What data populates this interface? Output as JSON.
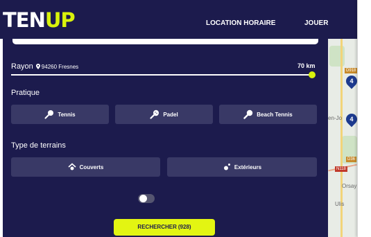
{
  "header": {
    "logo_part1": "TEN",
    "logo_part2": "UP",
    "nav": [
      "LOCATION HORAIRE",
      "JOUER"
    ]
  },
  "search": {
    "rayon_label": "Rayon",
    "location": "94260 Fresnes",
    "distance": "70 km",
    "distance_fraction": 1.0
  },
  "pratique": {
    "title": "Pratique",
    "options": [
      "Tennis",
      "Padel",
      "Beach Tennis"
    ]
  },
  "terrain": {
    "title": "Type de terrains",
    "options": [
      "Couverts",
      "Extérieurs"
    ]
  },
  "toggle": {
    "on": false
  },
  "submit": {
    "label": "RECHERCHER",
    "count": "(928)"
  },
  "map": {
    "pins": [
      "4",
      "4"
    ],
    "labels": [
      "en-Jo",
      "Orsay",
      "Ulis"
    ],
    "road_codes": [
      "D918",
      "D36",
      "N118"
    ]
  },
  "colors": {
    "panel": "#1c1b4d",
    "accent": "#d9f20c",
    "button": "#393966",
    "pin": "#1d3a8f"
  }
}
